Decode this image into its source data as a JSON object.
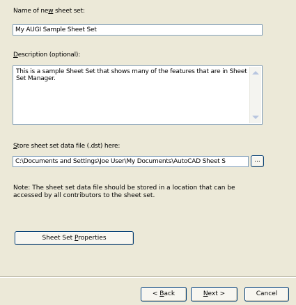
{
  "name_section": {
    "label_before": "Name of ne",
    "label_mnemonic": "w",
    "label_after": " sheet set:",
    "value": "My AUGI Sample Sheet Set"
  },
  "description_section": {
    "label_mnemonic": "D",
    "label_after": "escription (optional):",
    "value": "This is a sample Sheet Set that shows many of the features that are in Sheet Set Manager."
  },
  "store_section": {
    "label_mnemonic": "S",
    "label_after": "tore sheet set data file (.dst) here:",
    "path_value": "C:\\Documents and Settings\\Joe User\\My Documents\\AutoCAD Sheet S",
    "browse_label": "..."
  },
  "note_text": "Note: The sheet set data file should be stored in a location that can be accessed by all contributors to the sheet set.",
  "properties_button": {
    "label_before": "Sheet Set ",
    "label_mnemonic": "P",
    "label_after": "roperties"
  },
  "footer": {
    "back_before": "< ",
    "back_mnemonic": "B",
    "back_after": "ack",
    "next_mnemonic": "N",
    "next_after": "ext >",
    "cancel_label": "Cancel"
  }
}
